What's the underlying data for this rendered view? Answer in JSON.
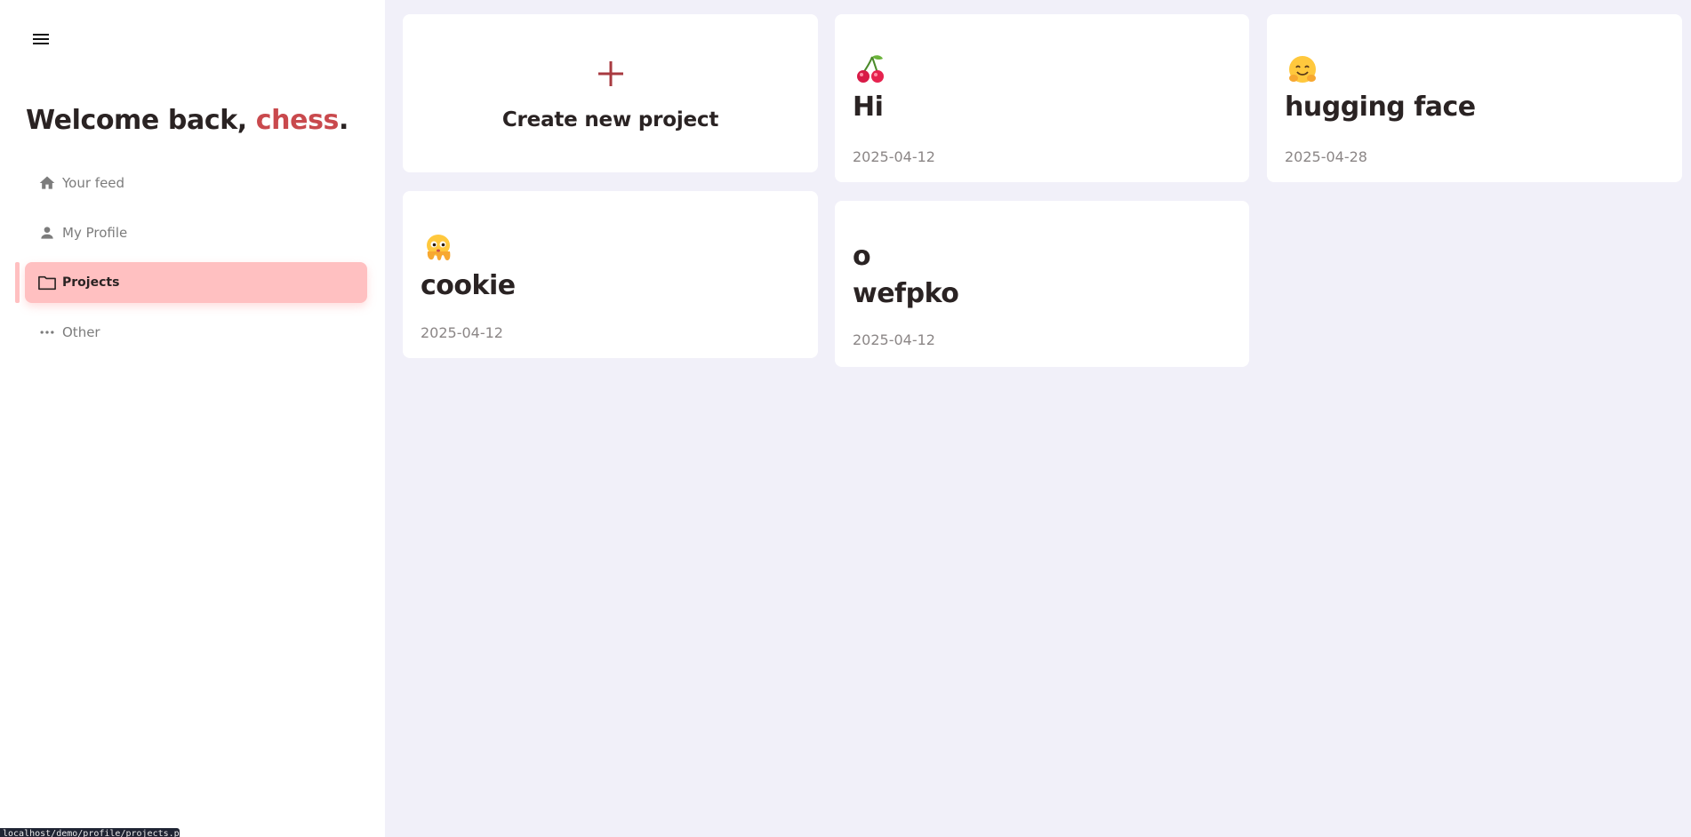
{
  "sidebar": {
    "welcome_prefix": "Welcome back, ",
    "username": "chess",
    "welcome_suffix": ".",
    "items": [
      {
        "label": "Your feed",
        "icon": "home-icon"
      },
      {
        "label": "My Profile",
        "icon": "person-icon"
      },
      {
        "label": "Projects",
        "icon": "folder-icon",
        "active": true
      },
      {
        "label": "Other",
        "icon": "more-dots-icon"
      }
    ]
  },
  "create_card": {
    "label": "Create new project",
    "icon": "plus-icon"
  },
  "projects": [
    {
      "emoji": "cherries-emoji",
      "title": "Hi",
      "date": "2025-04-12"
    },
    {
      "emoji": "hugging-face-emoji",
      "title": "hugging face",
      "date": "2025-04-28"
    },
    {
      "emoji": "hugging-octopus-emoji",
      "title": "cookie",
      "date": "2025-04-12"
    },
    {
      "emoji": "",
      "title": "o\nwefpko",
      "date": "2025-04-12"
    }
  ],
  "status_bar": {
    "url": "localhost/demo/profile/projects.php"
  },
  "colors": {
    "accent": "#c9494d",
    "active_nav": "#ffc0c1",
    "page_bg": "#f1f0f9",
    "card_bg": "#ffffff"
  }
}
